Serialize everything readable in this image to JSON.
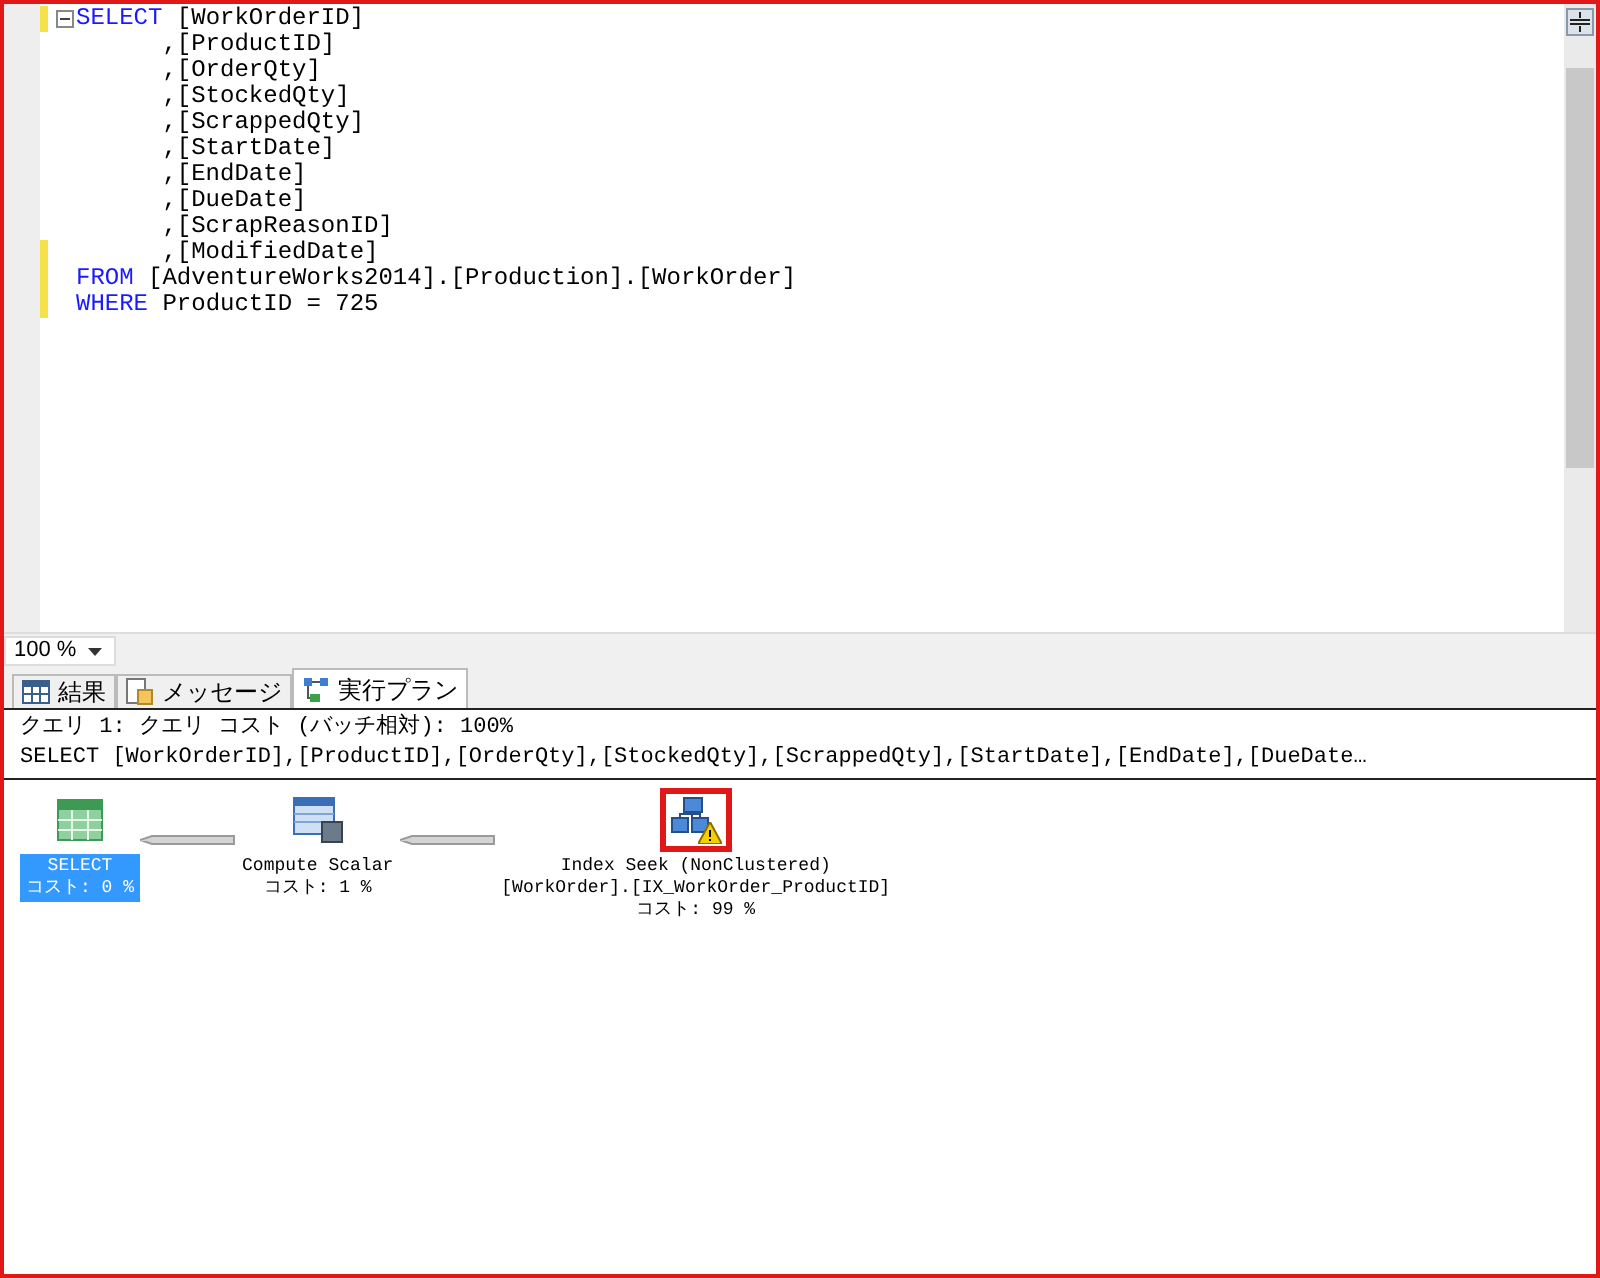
{
  "editor": {
    "lines": [
      {
        "modified": true,
        "parts": [
          {
            "kind": "keyword",
            "text": "SELECT"
          },
          {
            "kind": "plain",
            "text": " [WorkOrderID]"
          }
        ]
      },
      {
        "modified": false,
        "parts": [
          {
            "kind": "plain",
            "text": "      ,[ProductID]"
          }
        ]
      },
      {
        "modified": false,
        "parts": [
          {
            "kind": "plain",
            "text": "      ,[OrderQty]"
          }
        ]
      },
      {
        "modified": false,
        "parts": [
          {
            "kind": "plain",
            "text": "      ,[StockedQty]"
          }
        ]
      },
      {
        "modified": false,
        "parts": [
          {
            "kind": "plain",
            "text": "      ,[ScrappedQty]"
          }
        ]
      },
      {
        "modified": false,
        "parts": [
          {
            "kind": "plain",
            "text": "      ,[StartDate]"
          }
        ]
      },
      {
        "modified": false,
        "parts": [
          {
            "kind": "plain",
            "text": "      ,[EndDate]"
          }
        ]
      },
      {
        "modified": false,
        "parts": [
          {
            "kind": "plain",
            "text": "      ,[DueDate]"
          }
        ]
      },
      {
        "modified": false,
        "parts": [
          {
            "kind": "plain",
            "text": "      ,[ScrapReasonID]"
          }
        ]
      },
      {
        "modified": true,
        "parts": [
          {
            "kind": "plain",
            "text": "      ,[ModifiedDate]"
          }
        ]
      },
      {
        "modified": true,
        "parts": [
          {
            "kind": "keyword",
            "text": "FROM"
          },
          {
            "kind": "plain",
            "text": " [AdventureWorks2014].[Production].[WorkOrder]"
          }
        ]
      },
      {
        "modified": true,
        "parts": [
          {
            "kind": "keyword",
            "text": "WHERE"
          },
          {
            "kind": "plain",
            "text": " ProductID = 725"
          }
        ]
      }
    ]
  },
  "zoom": {
    "value": "100 %"
  },
  "tabs": [
    {
      "label": "結果",
      "selected": false
    },
    {
      "label": "メッセージ",
      "selected": false
    },
    {
      "label": "実行プラン",
      "selected": true
    }
  ],
  "plan": {
    "header": "クエリ 1: クエリ コスト (バッチ相対): 100%",
    "query": "SELECT [WorkOrderID],[ProductID],[OrderQty],[StockedQty],[ScrappedQty],[StartDate],[EndDate],[DueDate…",
    "nodes": [
      {
        "kind": "select",
        "name": "SELECT",
        "cost": "コスト: 0 %",
        "selected": true,
        "warning": false,
        "highlighted": false
      },
      {
        "kind": "compute",
        "name": "Compute Scalar",
        "cost": "コスト: 1 %",
        "selected": false,
        "warning": false,
        "highlighted": false
      },
      {
        "kind": "seek",
        "name": "Index Seek (NonClustered)",
        "object": "[WorkOrder].[IX_WorkOrder_ProductID]",
        "cost": "コスト: 99 %",
        "selected": false,
        "warning": true,
        "highlighted": true
      }
    ]
  }
}
